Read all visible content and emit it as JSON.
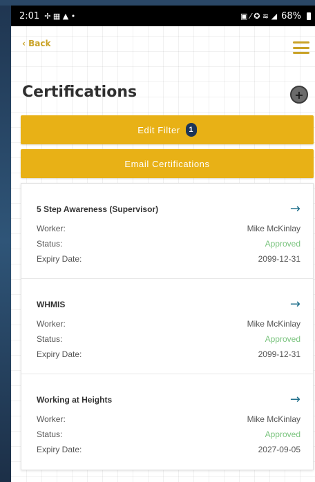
{
  "status_bar": {
    "time": "2:01",
    "battery": "68%"
  },
  "nav": {
    "back_label": "‹ Back"
  },
  "page": {
    "title": "Certifications"
  },
  "buttons": {
    "edit_filter_label": "Edit Filter",
    "filter_count": "1",
    "email_label": "Email Certifications"
  },
  "labels": {
    "worker": "Worker:",
    "status": "Status:",
    "expiry": "Expiry Date:"
  },
  "certifications": [
    {
      "title": "5 Step Awareness (Supervisor)",
      "worker": "Mike McKinlay",
      "status": "Approved",
      "expiry": "2099-12-31"
    },
    {
      "title": "WHMIS",
      "worker": "Mike McKinlay",
      "status": "Approved",
      "expiry": "2099-12-31"
    },
    {
      "title": "Working at Heights",
      "worker": "Mike McKinlay",
      "status": "Approved",
      "expiry": "2027-09-05"
    }
  ],
  "colors": {
    "accent": "#e8b116",
    "link": "#c9a227",
    "approved": "#7bc47f",
    "arrow": "#1f6f8b"
  }
}
